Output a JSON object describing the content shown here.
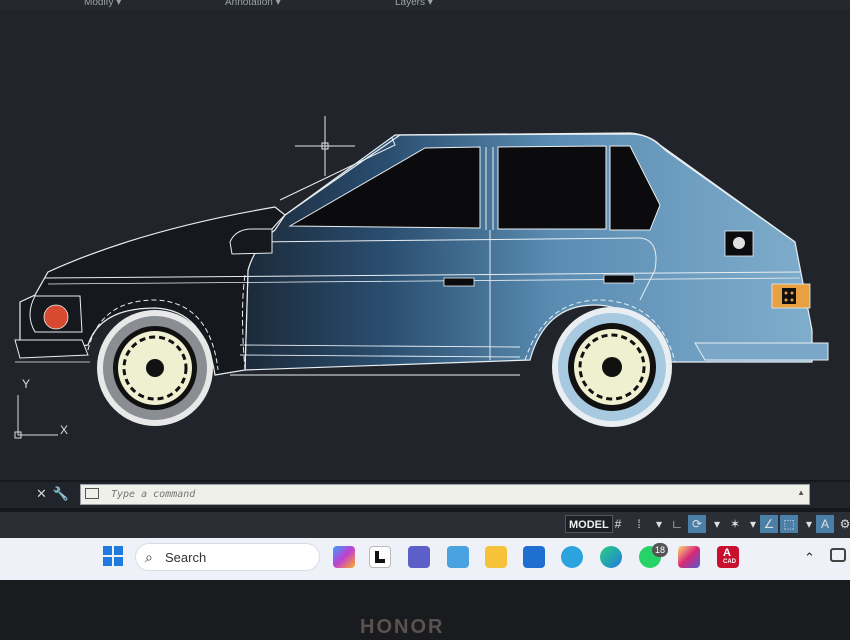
{
  "ribbon": {
    "panels": [
      "Modify ▾",
      "Annotation ▾",
      "Layers ▾"
    ]
  },
  "viewport": {
    "ucs_y": "Y",
    "ucs_x": "X"
  },
  "command_line": {
    "placeholder": "Type a command"
  },
  "status_bar": {
    "model_label": "MODEL",
    "icons": [
      "grid-icon",
      "snap-icon",
      "ortho-icon",
      "polar-icon",
      "osnap-icon",
      "lineweight-icon",
      "annotation-scale-icon"
    ]
  },
  "taskbar": {
    "search_label": "Search",
    "apps": [
      "copilot-icon",
      "file-icon",
      "teams-icon",
      "photos-icon",
      "file-explorer-icon",
      "microsoft-store-icon",
      "telegram-icon",
      "edge-icon",
      "whatsapp-icon",
      "instagram-icon",
      "autocad-icon"
    ],
    "whatsapp_badge": "18",
    "autocad_icon_text": "A",
    "autocad_icon_sub": "CAD"
  },
  "colors": {
    "viewport_bg": "#21252b",
    "car_body": "#7aa7c7",
    "wheel_cap": "#eef0d0",
    "taillight": "#e8a040",
    "headlight": "#d84a30",
    "accent": "#4a7fa8"
  },
  "bezel": {
    "brand": "HONOR"
  }
}
